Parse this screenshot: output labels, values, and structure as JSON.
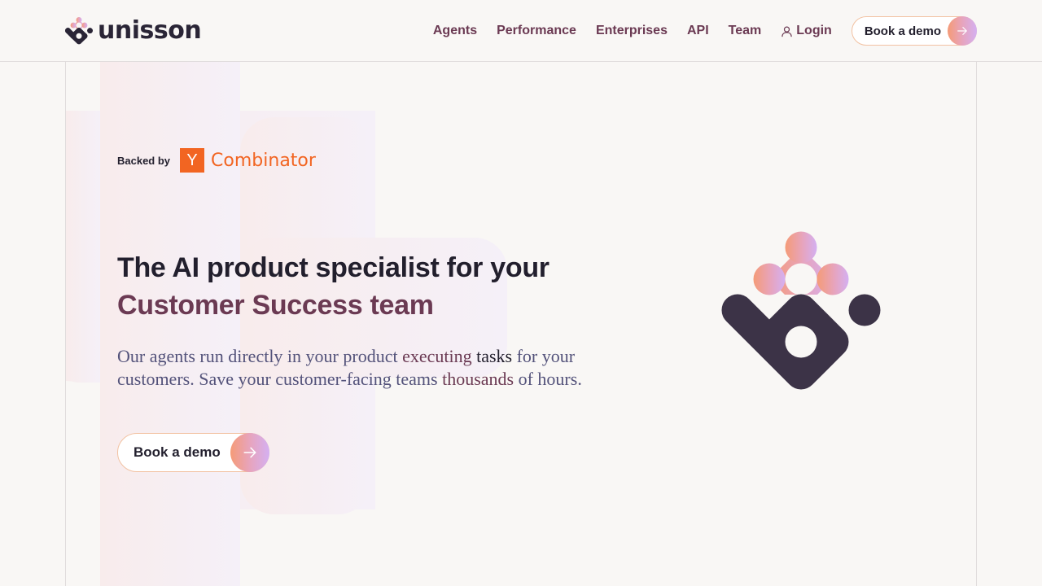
{
  "brand": {
    "name": "unisson",
    "logo_icon": "unisson-logo-icon"
  },
  "nav": {
    "links": [
      "Agents",
      "Performance",
      "Enterprises",
      "API",
      "Team"
    ],
    "login_label": "Login",
    "login_icon": "user-icon",
    "cta_label": "Book a demo",
    "cta_icon": "arrow-right-icon"
  },
  "hero": {
    "backed_label": "Backed by",
    "backer_logo_letter": "Y",
    "backer_name": "Combinator",
    "headline_line1": "The AI product specialist for your",
    "headline_line2": "Customer Success team",
    "subtitle_part1": "Our agents run directly in your product ",
    "subtitle_hl1": "executing",
    "subtitle_part2": " ",
    "subtitle_hl2": "tasks",
    "subtitle_part3": " for your customers. Save your customer-facing teams ",
    "subtitle_hl3": "thousands",
    "subtitle_part4": " of hours.",
    "cta_label": "Book a demo",
    "cta_icon": "arrow-right-icon",
    "illustration_icon": "unisson-mark-icon"
  },
  "colors": {
    "background": "#f9f7f5",
    "text_dark": "#221f2d",
    "accent_plum": "#6b3a53",
    "body_text": "#53527a",
    "yc_orange": "#f26522",
    "gradient_start": "#f59b77",
    "gradient_end": "#d4b0f2",
    "mark_dark": "#3c3347"
  }
}
